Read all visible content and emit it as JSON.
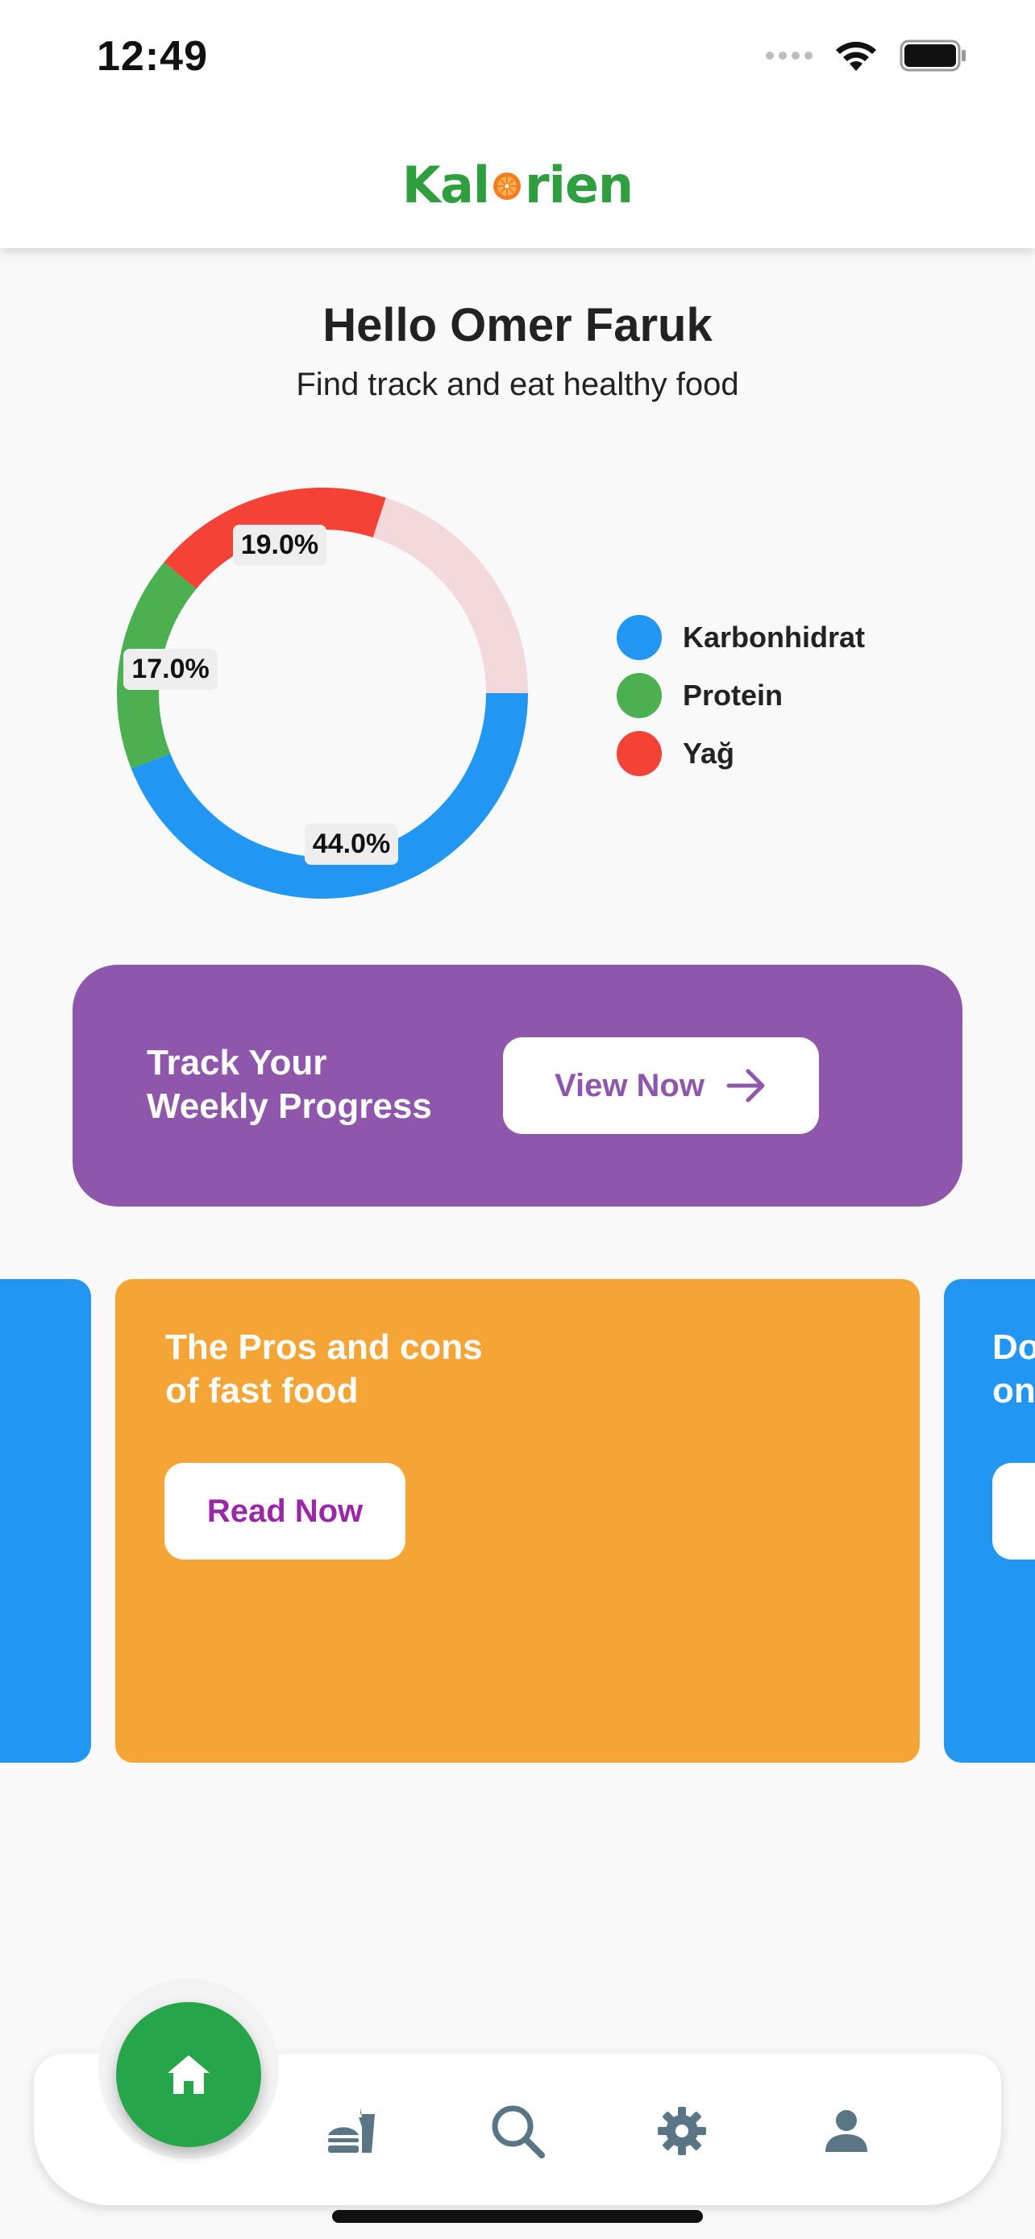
{
  "status_bar": {
    "time": "12:49"
  },
  "header": {
    "logo_text_left": "Kal",
    "logo_text_right": "rien"
  },
  "greeting": {
    "title": "Hello Omer Faruk",
    "subtitle": "Find track and eat healthy food"
  },
  "chart_data": {
    "type": "pie",
    "variant": "donut",
    "slices": [
      {
        "label": "Karbonhidrat",
        "value": 44.0,
        "display": "44.0%",
        "color": "#2196f3"
      },
      {
        "label": "Protein",
        "value": 17.0,
        "display": "17.0%",
        "color": "#4caf50"
      },
      {
        "label": "Yağ",
        "value": 19.0,
        "display": "19.0%",
        "color": "#f44336"
      },
      {
        "label": "",
        "value": 20.0,
        "display": "",
        "color": "#f3d9dc"
      }
    ],
    "legend": [
      "Karbonhidrat",
      "Protein",
      "Yağ"
    ],
    "legend_position": "right"
  },
  "progress_card": {
    "title_line1": "Track Your",
    "title_line2": "Weekly Progress",
    "button_label": "View Now",
    "color": "#8e57ab"
  },
  "articles": {
    "current": {
      "title_line1": "The Pros and cons",
      "title_line2": "of fast food",
      "button_label": "Read Now",
      "color": "#f5a536"
    },
    "next_peek": {
      "title_line1": "Do",
      "title_line2": "on"
    }
  },
  "bottom_nav": {
    "items": [
      "home-icon",
      "fastfood-icon",
      "search-icon",
      "gear-icon",
      "person-icon"
    ],
    "active": "home-icon",
    "accent": "#27a54a"
  }
}
